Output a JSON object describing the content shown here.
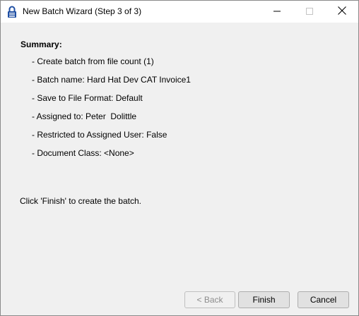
{
  "window": {
    "title": "New Batch Wizard (Step 3 of 3)",
    "app_icon": "padlock-icon",
    "controls": [
      "minimize-icon",
      "maximize-icon",
      "close-icon"
    ]
  },
  "summary": {
    "heading": "Summary:",
    "lines": [
      "- Create batch from file count (1)",
      "- Batch name: Hard Hat Dev CAT Invoice1",
      "- Save to File Format: Default",
      "- Assigned to: Peter  Dolittle",
      "- Restricted to Assigned User: False",
      "- Document Class: <None>"
    ]
  },
  "instruction": "Click 'Finish' to create the batch.",
  "buttons": {
    "back": "< Back",
    "finish": "Finish",
    "cancel": "Cancel"
  },
  "colors": {
    "window_bg": "#f0f0f0",
    "titlebar_bg": "#ffffff",
    "icon_blue": "#1f4fa3"
  }
}
